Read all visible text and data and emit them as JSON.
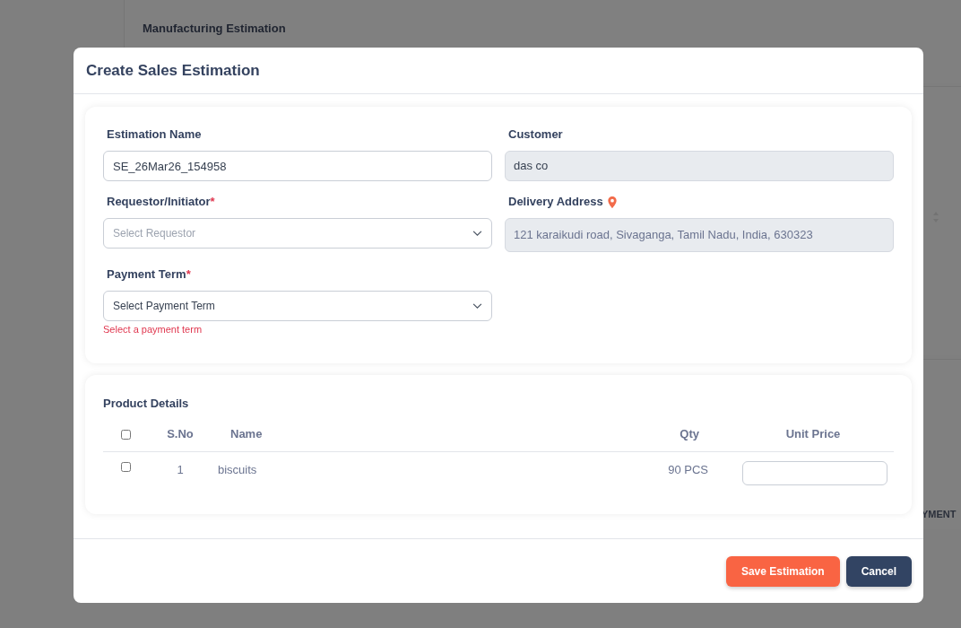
{
  "background": {
    "page_title": "Manufacturing Estimation",
    "cut_text": "YMENT"
  },
  "dialog": {
    "title": "Create Sales Estimation"
  },
  "fields": [
    {
      "label": "Estimation Name",
      "kind": "text",
      "value": "SE_26Mar26_154958"
    },
    {
      "label": "Customer",
      "kind": "readonly",
      "value": "das co"
    },
    {
      "label": "Requestor/Initiator",
      "kind": "select",
      "required_mark": "*",
      "placeholder": "Select Requestor"
    },
    {
      "label": "Delivery Address",
      "kind": "readonly",
      "pin": true,
      "value": "121 karaikudi road, Sivaganga, Tamil Nadu, India, 630323"
    },
    {
      "label": "Payment Term",
      "kind": "select",
      "required_mark": "*",
      "value": "Select Payment Term",
      "error": "Select a payment term"
    }
  ],
  "products": {
    "title": "Product Details",
    "select_all": {
      "checked": false
    },
    "columns": [
      "S.No",
      "Name",
      "Qty",
      "Unit Price"
    ],
    "rows": [
      {
        "checked": false,
        "sno": "1",
        "name": "biscuits",
        "qty": "90 PCS"
      }
    ]
  },
  "buttons": [
    {
      "label": "Save Estimation",
      "kind": "primary"
    },
    {
      "label": "Cancel",
      "kind": "secondary"
    }
  ]
}
